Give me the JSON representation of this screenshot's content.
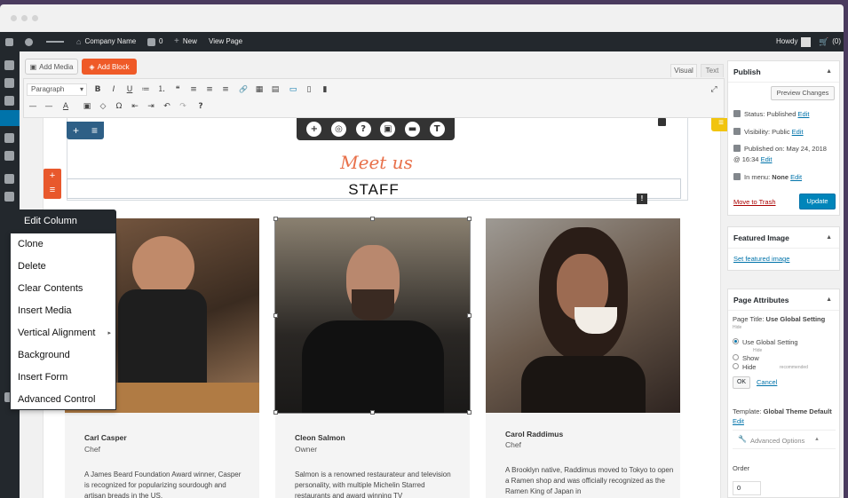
{
  "adminbar": {
    "site_name": "Company Name",
    "comments_count": "0",
    "new_label": "New",
    "view_label": "View Page",
    "howdy": "Howdy",
    "cart_count": "(0)"
  },
  "editor": {
    "add_media": "Add Media",
    "add_block": "Add Block",
    "tab_visual": "Visual",
    "tab_text": "Text",
    "format_select": "Paragraph",
    "toolbar_row1": [
      "B",
      "I",
      "U",
      "≔",
      "⒈",
      "❝",
      "≡",
      "≡",
      "≡",
      "🔗",
      "▦",
      "▤",
      "▭",
      "▯",
      "▮"
    ],
    "toolbar_row2": [
      "—",
      "—",
      "A",
      "▣",
      "◇",
      "Ω",
      "⇤",
      "⇥",
      "↶",
      "↷",
      "?"
    ]
  },
  "content": {
    "heading_script": "Meet us",
    "heading_main": "STAFF",
    "float_toolbar": [
      "+",
      "◎",
      "?",
      "▣",
      "▬",
      "T"
    ],
    "team": [
      {
        "name": "Carl Casper",
        "role": "Chef",
        "bio": "A James Beard Foundation Award winner, Casper is recognized for popularizing sourdough and artisan breads in the US.",
        "photo_bg": "#5a4534"
      },
      {
        "name": "Cleon Salmon",
        "role": "Owner",
        "bio": "Salmon is a renowned restaurateur and television personality, with multiple Michelin Starred restaurants and award winning TV",
        "photo_bg": "#3b3734"
      },
      {
        "name": "Carol Raddimus",
        "role": "Chef",
        "bio": "A Brooklyn native, Raddimus moved to Tokyo to open a Ramen shop and was officially recognized as the Ramen King of Japan in",
        "photo_bg": "#4b3a32"
      }
    ]
  },
  "context_menu": {
    "title": "Edit Column",
    "items": [
      "Clone",
      "Delete",
      "Clear Contents",
      "Insert Media",
      "Vertical Alignment",
      "Background",
      "Insert Form",
      "Advanced Control"
    ],
    "submenu_arrow": "▸"
  },
  "sidebar": {
    "publish": {
      "title": "Publish",
      "preview": "Preview Changes",
      "status_label": "Status:",
      "status_value": "Published",
      "visibility_label": "Visibility:",
      "visibility_value": "Public",
      "published_on": "Published on: May 24, 2018",
      "published_time": "@ 16:34",
      "menu_label": "In menu:",
      "menu_value": "None",
      "edit": "Edit",
      "trash": "Move to Trash",
      "update": "Update"
    },
    "featured": {
      "title": "Featured Image",
      "link": "Set featured image"
    },
    "attributes": {
      "title": "Page Attributes",
      "page_title_label": "Page Title:",
      "page_title_value": "Use Global Setting",
      "hide_small": "Hide",
      "opt_global": "Use Global Setting",
      "opt_global_sub": "Hide",
      "opt_show": "Show",
      "opt_hide": "Hide",
      "opt_hide_note": "recommended",
      "ok": "OK",
      "cancel": "Cancel",
      "template_label": "Template:",
      "template_value": "Global Theme Default",
      "edit": "Edit",
      "advanced": "Advanced Options",
      "order_label": "Order",
      "order_value": "0"
    },
    "toggle_arrow": "▲"
  },
  "colors": {
    "accent_orange": "#ef5a28",
    "wp_blue": "#0073aa",
    "admin_dark": "#23282d",
    "script_heading": "#e8704a"
  }
}
